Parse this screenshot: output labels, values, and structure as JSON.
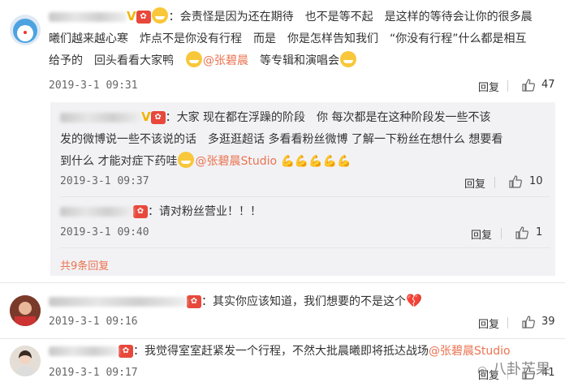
{
  "comments": [
    {
      "id": "c1",
      "text_lines": [
        "：会责怪是因为还在期待　也不是等不起　是这样的等待会让你的很多晨",
        "曦们越来越心寒　炸点不是你没有行程　而是　你是怎样告知我们　“你没有行程”什么都是相互",
        "给予的　回头看看大家鸭　",
        "等专辑和演唱会"
      ],
      "mention": "@张碧晨",
      "time": "2019-3-1 09:31",
      "reply_label": "回复",
      "likes": "47"
    },
    {
      "id": "c2",
      "text_lines": [
        "：大家 现在都在浮躁的阶段　你 每次都是在这种阶段发一些不该",
        "发的微博说一些不该说的话　多逛逛超话 多看看粉丝微博 了解一下粉丝在想什么 想要看",
        "到什么 才能对症下药哇"
      ],
      "mention": "@张碧晨Studio",
      "time": "2019-3-1 09:37",
      "reply_label": "回复",
      "likes": "10"
    },
    {
      "id": "c3",
      "text": "：请对粉丝营业！！！",
      "time": "2019-3-1 09:40",
      "reply_label": "回复",
      "likes": "1"
    },
    {
      "id": "c4",
      "text": "：其实你应该知道，我们想要的不是这个",
      "time": "2019-3-1 09:16",
      "reply_label": "回复",
      "likes": "39"
    },
    {
      "id": "c5",
      "text": "：我觉得室室赶紧发一个行程，不然大批晨曦即将抵达战场",
      "mention": "@张碧晨Studio",
      "time": "2019-3-1 09:17",
      "reply_label": "回复",
      "likes": "41"
    }
  ],
  "expand_replies": "共9条回复",
  "watermark": "八卦芒果",
  "colors": {
    "link": "#eb7350",
    "sub_bg": "#f2f2f5",
    "text": "#333333"
  }
}
